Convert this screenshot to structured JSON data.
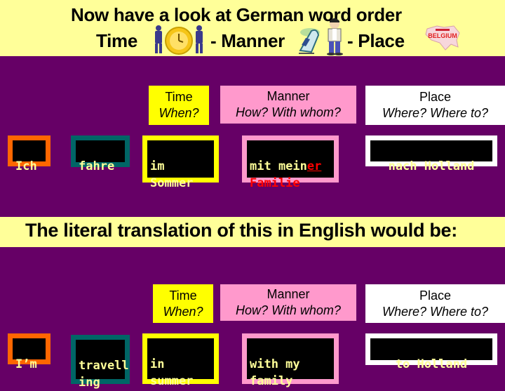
{
  "slide": {
    "colors": {
      "background": "#660066",
      "band": "#FFFF99",
      "time": "#FFFF00",
      "manner": "#FF99CC",
      "place": "#FFFFFF",
      "subject": "#FF6600",
      "verb": "#006666",
      "word_text": "#FFFF99",
      "highlight": "#FF0000"
    },
    "title": {
      "line1": "Now have a look at German word order",
      "time": "Time",
      "manner": "- Manner",
      "place": "- Place",
      "icons": [
        "clock-with-businessmen-icon",
        "train-and-boy-icon",
        "belgium-map-icon"
      ],
      "map_label": "BELGIUM"
    },
    "headers": {
      "time": {
        "title": "Time",
        "question": "When?"
      },
      "manner": {
        "title": "Manner",
        "question": "How? With whom?"
      },
      "place": {
        "title": "Place",
        "question": "Where? Where to?"
      }
    },
    "german": {
      "subject": "Ich",
      "verb": "fahre",
      "time": "im\nSommer",
      "manner_part1": "mit mein",
      "manner_ending": "er",
      "manner_part2": "Familie",
      "place": "nach Holland"
    },
    "translation_heading": "The literal translation of this in English would be:",
    "english": {
      "subject": "I’m",
      "verb": "travell\ning",
      "time": "in\nsummer",
      "manner": "with my\nfamily",
      "place": "to Holland"
    }
  }
}
